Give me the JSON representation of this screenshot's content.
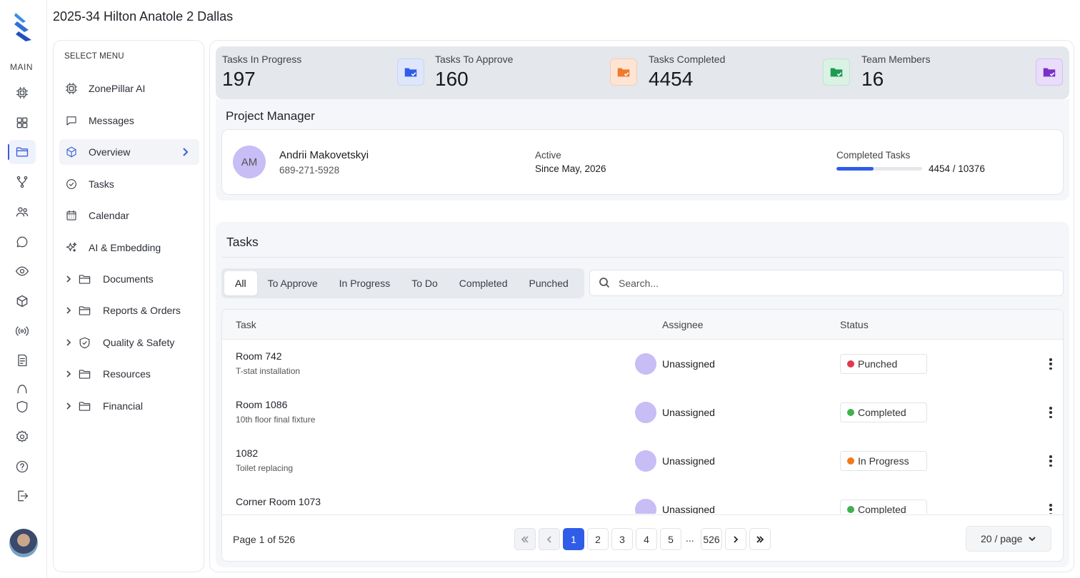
{
  "header": {
    "title": "2025-34 Hilton Anatole 2 Dallas"
  },
  "rail": {
    "main_label": "MAIN",
    "icons": [
      "chip-icon",
      "grid-icon",
      "folder-icon",
      "branch-icon",
      "users-icon",
      "chat-icon",
      "eye-icon",
      "cube-icon",
      "broadcast-icon",
      "document-icon",
      "arch-icon",
      "shield-icon",
      "settings-icon",
      "help-icon",
      "logout-icon"
    ],
    "accent": "#3a5fd9"
  },
  "menu": {
    "heading": "SELECT MENU",
    "items": [
      {
        "label": "ZonePillar AI",
        "icon": "chip-icon"
      },
      {
        "label": "Messages",
        "icon": "message-icon"
      },
      {
        "label": "Overview",
        "icon": "cube-icon",
        "active": true
      },
      {
        "label": "Tasks",
        "icon": "check-circle-icon"
      },
      {
        "label": "Calendar",
        "icon": "calendar-icon"
      },
      {
        "label": "AI & Embedding",
        "icon": "sparkles-icon"
      }
    ],
    "folders": [
      {
        "label": "Documents",
        "icon": "folder-icon"
      },
      {
        "label": "Reports & Orders",
        "icon": "folder-icon"
      },
      {
        "label": "Quality & Safety",
        "icon": "shield-check-icon"
      },
      {
        "label": "Resources",
        "icon": "folder-icon"
      },
      {
        "label": "Financial",
        "icon": "folder-icon"
      }
    ]
  },
  "stats": [
    {
      "label": "Tasks In Progress",
      "value": "197",
      "icon": "folder-check-icon",
      "bg": "#dfe6fb",
      "color": "#2f5de8"
    },
    {
      "label": "Tasks To Approve",
      "value": "160",
      "icon": "folder-check-icon",
      "bg": "#fde4d3",
      "color": "#f07a2c"
    },
    {
      "label": "Tasks Completed",
      "value": "4454",
      "icon": "folder-check-icon",
      "bg": "#d9f2e3",
      "color": "#1f9a52"
    },
    {
      "label": "Team Members",
      "value": "16",
      "icon": "folder-check-icon",
      "bg": "#e9ddfa",
      "color": "#7a2fc9"
    }
  ],
  "project_manager": {
    "title": "Project Manager",
    "initials": "AM",
    "name": "Andrii Makovetskyi",
    "phone": "689-271-5928",
    "active_label": "Active",
    "active_since": "Since May, 2026",
    "completed_label": "Completed Tasks",
    "completed_value": "4454 / 10376",
    "completed_fraction": 0.43
  },
  "tasks": {
    "title": "Tasks",
    "tabs": [
      "All",
      "To Approve",
      "In Progress",
      "To Do",
      "Completed",
      "Punched"
    ],
    "active_tab": "All",
    "search_placeholder": "Search...",
    "columns": [
      "Task",
      "Assignee",
      "Status"
    ],
    "rows": [
      {
        "name": "Room 742",
        "sub": "T-stat installation",
        "assignee": "Unassigned",
        "status": "Punched",
        "status_color": "#e0384f"
      },
      {
        "name": "Room 1086",
        "sub": "10th floor final fixture",
        "assignee": "Unassigned",
        "status": "Completed",
        "status_color": "#3fb24f"
      },
      {
        "name": "1082",
        "sub": "Toilet replacing",
        "assignee": "Unassigned",
        "status": "In Progress",
        "status_color": "#f07a1a"
      },
      {
        "name": "Corner Room 1073",
        "sub": "",
        "assignee": "Unassigned",
        "status": "Completed",
        "status_color": "#3fb24f"
      }
    ],
    "pagination": {
      "info": "Page 1 of 526",
      "pages": [
        "1",
        "2",
        "3",
        "4",
        "5"
      ],
      "current": "1",
      "ellipsis": "...",
      "last": "526",
      "per_page": "20 / page"
    }
  }
}
